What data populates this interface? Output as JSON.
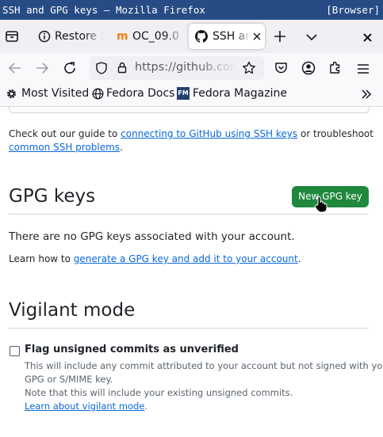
{
  "window": {
    "title": "SSH and GPG keys — Mozilla Firefox",
    "badge": "[Browser]"
  },
  "tabs": [
    {
      "label": "Restore S"
    },
    {
      "label": "OC_09.0"
    },
    {
      "label": "SSH an"
    }
  ],
  "tab_favicon_text": "m",
  "navbar": {
    "url": "https://github.com/"
  },
  "bookmarks": [
    {
      "label": "Most Visited"
    },
    {
      "label": "Fedora Docs"
    },
    {
      "label": "Fedora Magazine"
    }
  ],
  "bookmark_fm_text": "FM",
  "ssh_section": {
    "text_before": "Check out our guide to ",
    "link1": "connecting to GitHub using SSH keys",
    "text_middle": " or troubleshoot",
    "link2": "common SSH problems",
    "text_end": "."
  },
  "gpg_section": {
    "heading": "GPG keys",
    "new_button": "New GPG key",
    "empty_message": "There are no GPG keys associated with your account.",
    "learn_prefix": "Learn how to ",
    "learn_link": "generate a GPG key and add it to your account",
    "learn_suffix": "."
  },
  "vigilant_section": {
    "heading": "Vigilant mode",
    "checkbox_label": "Flag unsigned commits as unverified",
    "checkbox_checked": false,
    "desc_line1": "This will include any commit attributed to your account but not signed with your",
    "desc_line2": "GPG or S/MIME key.",
    "note": "Note that this will include your existing unsigned commits.",
    "learn_link": "Learn about vigilant mode",
    "learn_suffix": "."
  },
  "colors": {
    "titlebar": "#274b84",
    "link": "#0969da",
    "button_green": "#1f883d",
    "tabbar": "#f0f0f4"
  }
}
